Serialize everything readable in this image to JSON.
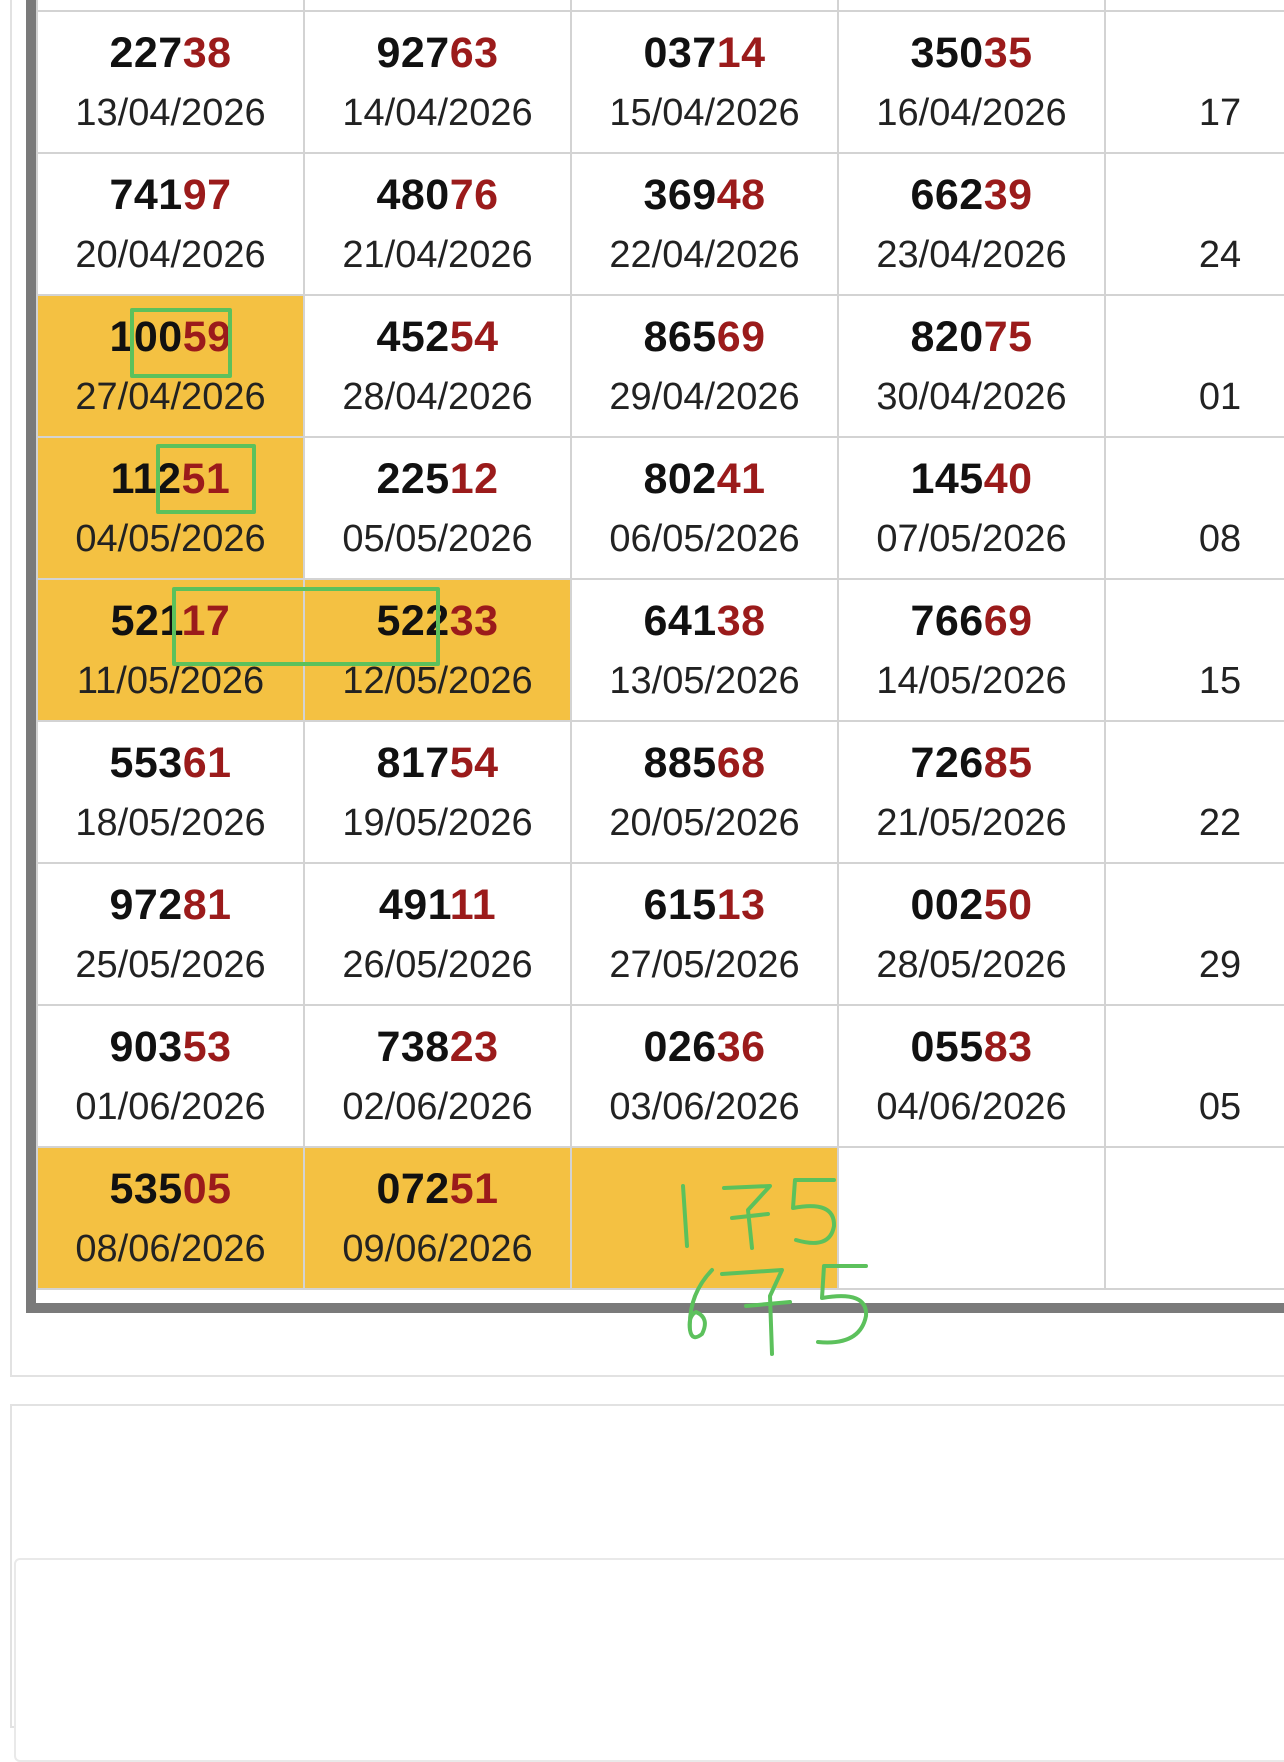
{
  "rows": [
    [
      {
        "lead": "",
        "tail": "",
        "date": ""
      },
      {
        "lead": "",
        "tail": "",
        "date": ""
      },
      {
        "lead": "",
        "tail": "",
        "date": ""
      },
      {
        "lead": "",
        "tail": "",
        "date": ""
      },
      {
        "lead": "",
        "tail": "",
        "date": ""
      }
    ],
    [
      {
        "lead": "227",
        "tail": "38",
        "date": "13/04/2026"
      },
      {
        "lead": "927",
        "tail": "63",
        "date": "14/04/2026"
      },
      {
        "lead": "037",
        "tail": "14",
        "date": "15/04/2026"
      },
      {
        "lead": "350",
        "tail": "35",
        "date": "16/04/2026"
      },
      {
        "lead": "",
        "tail": "",
        "date": "17"
      }
    ],
    [
      {
        "lead": "741",
        "tail": "97",
        "date": "20/04/2026"
      },
      {
        "lead": "480",
        "tail": "76",
        "date": "21/04/2026"
      },
      {
        "lead": "369",
        "tail": "48",
        "date": "22/04/2026"
      },
      {
        "lead": "662",
        "tail": "39",
        "date": "23/04/2026"
      },
      {
        "lead": "",
        "tail": "",
        "date": "24"
      }
    ],
    [
      {
        "lead": "100",
        "tail": "59",
        "date": "27/04/2026",
        "highlight": true
      },
      {
        "lead": "452",
        "tail": "54",
        "date": "28/04/2026"
      },
      {
        "lead": "865",
        "tail": "69",
        "date": "29/04/2026"
      },
      {
        "lead": "820",
        "tail": "75",
        "date": "30/04/2026"
      },
      {
        "lead": "",
        "tail": "",
        "date": "01"
      }
    ],
    [
      {
        "lead": "112",
        "tail": "51",
        "date": "04/05/2026",
        "highlight": true
      },
      {
        "lead": "225",
        "tail": "12",
        "date": "05/05/2026"
      },
      {
        "lead": "802",
        "tail": "41",
        "date": "06/05/2026"
      },
      {
        "lead": "145",
        "tail": "40",
        "date": "07/05/2026"
      },
      {
        "lead": "",
        "tail": "",
        "date": "08"
      }
    ],
    [
      {
        "lead": "521",
        "tail": "17",
        "date": "11/05/2026",
        "highlight": true
      },
      {
        "lead": "522",
        "tail": "33",
        "date": "12/05/2026",
        "highlight": true
      },
      {
        "lead": "641",
        "tail": "38",
        "date": "13/05/2026"
      },
      {
        "lead": "766",
        "tail": "69",
        "date": "14/05/2026"
      },
      {
        "lead": "",
        "tail": "",
        "date": "15"
      }
    ],
    [
      {
        "lead": "553",
        "tail": "61",
        "date": "18/05/2026"
      },
      {
        "lead": "817",
        "tail": "54",
        "date": "19/05/2026"
      },
      {
        "lead": "885",
        "tail": "68",
        "date": "20/05/2026"
      },
      {
        "lead": "726",
        "tail": "85",
        "date": "21/05/2026"
      },
      {
        "lead": "",
        "tail": "",
        "date": "22"
      }
    ],
    [
      {
        "lead": "972",
        "tail": "81",
        "date": "25/05/2026"
      },
      {
        "lead": "491",
        "tail": "11",
        "date": "26/05/2026"
      },
      {
        "lead": "615",
        "tail": "13",
        "date": "27/05/2026"
      },
      {
        "lead": "002",
        "tail": "50",
        "date": "28/05/2026"
      },
      {
        "lead": "",
        "tail": "",
        "date": "29"
      }
    ],
    [
      {
        "lead": "903",
        "tail": "53",
        "date": "01/06/2026"
      },
      {
        "lead": "738",
        "tail": "23",
        "date": "02/06/2026"
      },
      {
        "lead": "026",
        "tail": "36",
        "date": "03/06/2026"
      },
      {
        "lead": "055",
        "tail": "83",
        "date": "04/06/2026"
      },
      {
        "lead": "",
        "tail": "",
        "date": "05"
      }
    ],
    [
      {
        "lead": "535",
        "tail": "05",
        "date": "08/06/2026",
        "highlight": true
      },
      {
        "lead": "072",
        "tail": "51",
        "date": "09/06/2026",
        "highlight": true
      },
      {
        "lead": "",
        "tail": "",
        "date": "",
        "highlight": true
      },
      {
        "lead": "",
        "tail": "",
        "date": ""
      },
      {
        "lead": "",
        "tail": "",
        "date": ""
      }
    ]
  ],
  "handwritten_notes": [
    "175",
    "675"
  ],
  "colors": {
    "highlight": "#f4c142",
    "tail_digits": "#9b1b1b",
    "annotation": "#5cc15c",
    "frame": "#7a7a7a"
  }
}
